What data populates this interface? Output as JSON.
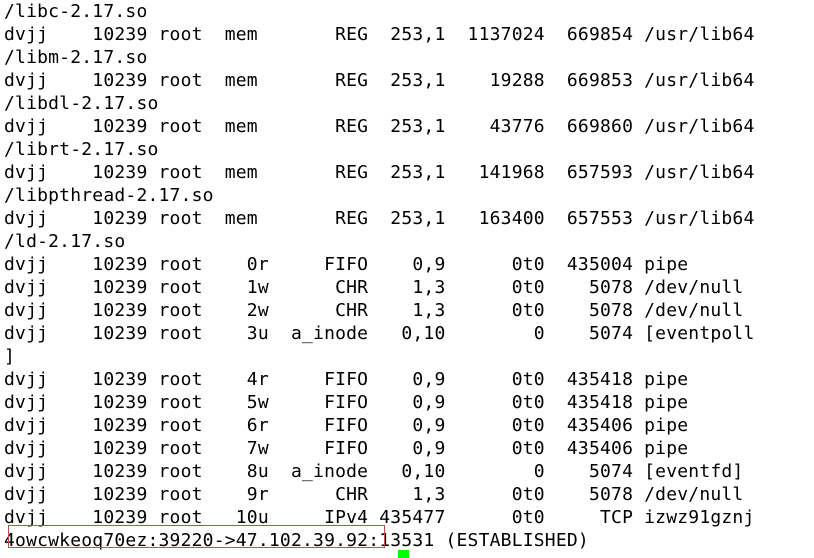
{
  "terminal": {
    "lines": [
      "/libc-2.17.so",
      "dvjj    10239 root  mem       REG  253,1  1137024  669854 /usr/lib64",
      "/libm-2.17.so",
      "dvjj    10239 root  mem       REG  253,1    19288  669853 /usr/lib64",
      "/libdl-2.17.so",
      "dvjj    10239 root  mem       REG  253,1    43776  669860 /usr/lib64",
      "/librt-2.17.so",
      "dvjj    10239 root  mem       REG  253,1   141968  657593 /usr/lib64",
      "/libpthread-2.17.so",
      "dvjj    10239 root  mem       REG  253,1   163400  657553 /usr/lib64",
      "/ld-2.17.so",
      "dvjj    10239 root    0r     FIFO    0,9      0t0  435004 pipe",
      "dvjj    10239 root    1w      CHR    1,3      0t0    5078 /dev/null",
      "dvjj    10239 root    2w      CHR    1,3      0t0    5078 /dev/null",
      "dvjj    10239 root    3u  a_inode   0,10        0    5074 [eventpoll",
      "]",
      "dvjj    10239 root    4r     FIFO    0,9      0t0  435418 pipe",
      "dvjj    10239 root    5w     FIFO    0,9      0t0  435418 pipe",
      "dvjj    10239 root    6r     FIFO    0,9      0t0  435406 pipe",
      "dvjj    10239 root    7w     FIFO    0,9      0t0  435406 pipe",
      "dvjj    10239 root    8u  a_inode   0,10        0    5074 [eventfd]",
      "dvjj    10239 root    9r      CHR    1,3      0t0    5078 /dev/null",
      "dvjj    10239 root   10u     IPv4 435477      0t0     TCP izwz91gznj",
      "4owcwkeoq70ez:39220->47.102.39.92:13531 (ESTABLISHED)"
    ]
  },
  "colors": {
    "background": "#ffffff",
    "text": "#000000",
    "highlight_border": "#c0504d",
    "cursor": "#00ff00"
  }
}
